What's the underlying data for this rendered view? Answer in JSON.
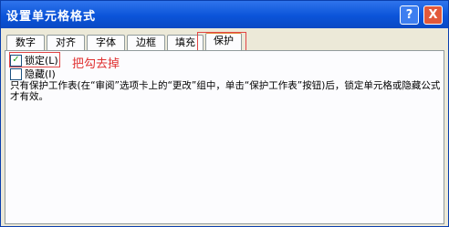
{
  "window": {
    "title": "设置单元格格式",
    "help_label": "?",
    "close_label": "X"
  },
  "tabs": [
    {
      "label": "数字"
    },
    {
      "label": "对齐"
    },
    {
      "label": "字体"
    },
    {
      "label": "边框"
    },
    {
      "label": "填充"
    },
    {
      "label": "保护"
    }
  ],
  "active_tab": "保护",
  "options": {
    "locked": {
      "label": "锁定(L)",
      "checked": true
    },
    "hidden": {
      "label": "隐藏(I)",
      "checked": false
    }
  },
  "annotation": "把勾去掉",
  "description": "只有保护工作表(在“审阅”选项卡上的“更改”组中，单击“保护工作表”按钮)后，锁定单元格或隐藏公式才有效。",
  "colors": {
    "titlebar": "#0b54d9",
    "annotation_red": "#e03030",
    "active_tab_accent": "#e08a3b"
  }
}
